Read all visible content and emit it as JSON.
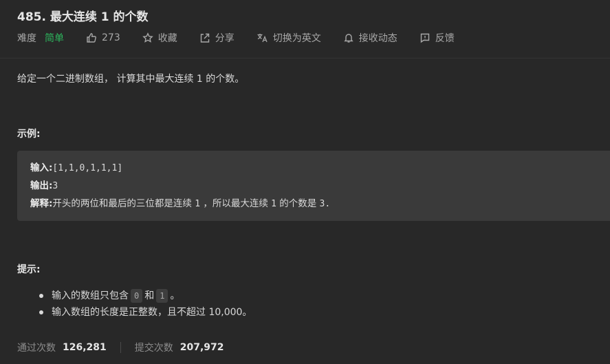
{
  "problem": {
    "title": "485. 最大连续 1 的个数",
    "difficulty_label": "难度",
    "difficulty_value": "简单",
    "likes": "273",
    "collect_label": "收藏",
    "share_label": "分享",
    "switch_lang_label": "切换为英文",
    "notify_label": "接收动态",
    "feedback_label": "反馈"
  },
  "description": "给定一个二进制数组， 计算其中最大连续 1 的个数。",
  "example": {
    "section_title": "示例:",
    "input_label": "输入:",
    "input_value": "[1,1,0,1,1,1]",
    "output_label": "输出:",
    "output_value": "3",
    "explain_label": "解释:",
    "explain_parts": [
      "开头的两位和最后的三位都是连续 ",
      "1",
      " ，所以最大连续 ",
      "1",
      " 的个数是 ",
      "3."
    ]
  },
  "hints": {
    "section_title": "提示:",
    "item1": {
      "prefix": "输入的数组只包含",
      "chip1": "0",
      "mid": "和",
      "chip2": "1",
      "suffix": "。"
    },
    "item2": "输入数组的长度是正整数，且不超过 10,000。"
  },
  "stats": {
    "accepted_label": "通过次数",
    "accepted_value": "126,281",
    "submitted_label": "提交次数",
    "submitted_value": "207,972"
  },
  "colors": {
    "background": "#282828",
    "easy_green": "#2db55d",
    "code_block": "#3a3a3a"
  }
}
